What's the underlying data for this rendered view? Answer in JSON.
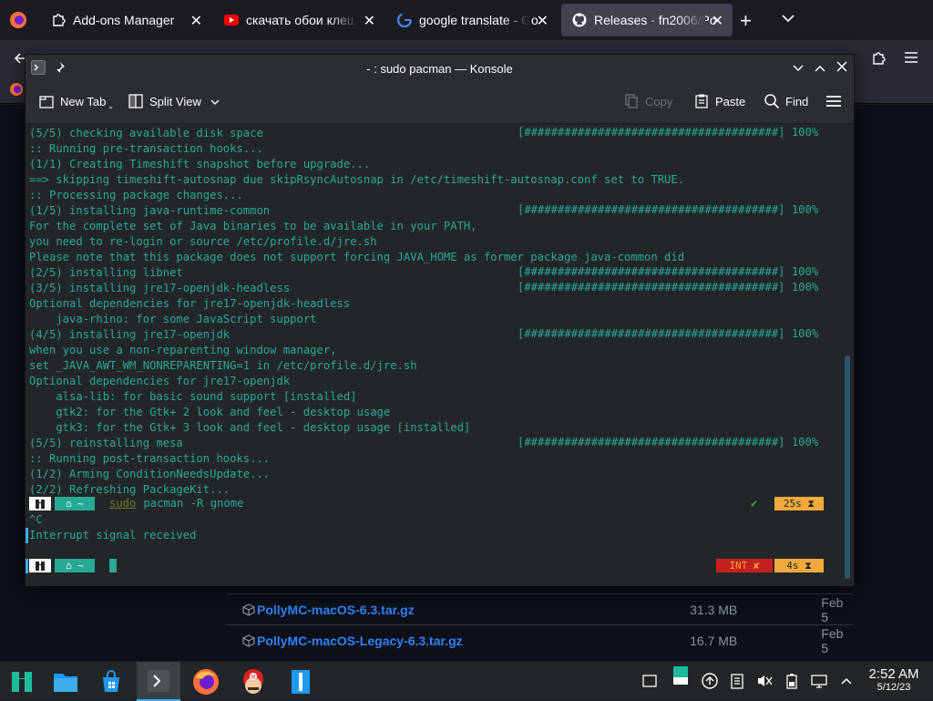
{
  "browser": {
    "tabs": [
      {
        "title": "Add-ons Manager",
        "icon": "puzzle-icon",
        "active": false
      },
      {
        "title": "скачать обои клеш р",
        "icon": "youtube-icon",
        "active": false
      },
      {
        "title": "google translate - Go",
        "icon": "google-icon",
        "active": false
      },
      {
        "title": "Releases · fn2006/Po",
        "icon": "github-icon",
        "active": true
      }
    ],
    "new_tab": "+",
    "list_tabs": "⌄"
  },
  "releases": {
    "assets": [
      {
        "name": "PollyMC-macOS-6.3.tar.gz",
        "size": "31.3 MB",
        "date": "Feb 5"
      },
      {
        "name": "PollyMC-macOS-Legacy-6.3.tar.gz",
        "size": "16.7 MB",
        "date": "Feb 5"
      }
    ]
  },
  "konsole": {
    "title": "- : sudo pacman — Konsole",
    "toolbar": {
      "new_tab": "New Tab",
      "split_view": "Split View",
      "copy": "Copy",
      "paste": "Paste",
      "find": "Find"
    },
    "lines": [
      {
        "text": "(5/5) checking available disk space",
        "bar": "[######################################] 100%"
      },
      {
        "text": ":: Running pre-transaction hooks...",
        "bar": ""
      },
      {
        "text": "(1/1) Creating Timeshift snapshot before upgrade...",
        "bar": ""
      },
      {
        "text": "==> skipping timeshift-autosnap due skipRsyncAutosnap in /etc/timeshift-autosnap.conf set to TRUE.",
        "bar": ""
      },
      {
        "text": ":: Processing package changes...",
        "bar": ""
      },
      {
        "text": "(1/5) installing java-runtime-common",
        "bar": "[######################################] 100%"
      },
      {
        "text": "For the complete set of Java binaries to be available in your PATH,",
        "bar": ""
      },
      {
        "text": "you need to re-login or source /etc/profile.d/jre.sh",
        "bar": ""
      },
      {
        "text": "Please note that this package does not support forcing JAVA_HOME as former package java-common did",
        "bar": ""
      },
      {
        "text": "(2/5) installing libnet",
        "bar": "[######################################] 100%"
      },
      {
        "text": "(3/5) installing jre17-openjdk-headless",
        "bar": "[######################################] 100%"
      },
      {
        "text": "Optional dependencies for jre17-openjdk-headless",
        "bar": ""
      },
      {
        "text": "    java-rhino: for some JavaScript support",
        "bar": ""
      },
      {
        "text": "(4/5) installing jre17-openjdk",
        "bar": "[######################################] 100%"
      },
      {
        "text": "when you use a non-reparenting window manager,",
        "bar": ""
      },
      {
        "text": "set _JAVA_AWT_WM_NONREPARENTING=1 in /etc/profile.d/jre.sh",
        "bar": ""
      },
      {
        "text": "Optional dependencies for jre17-openjdk",
        "bar": ""
      },
      {
        "text": "    alsa-lib: for basic sound support [installed]",
        "bar": ""
      },
      {
        "text": "    gtk2: for the Gtk+ 2 look and feel - desktop usage",
        "bar": ""
      },
      {
        "text": "    gtk3: for the Gtk+ 3 look and feel - desktop usage [installed]",
        "bar": ""
      },
      {
        "text": "(5/5) reinstalling mesa",
        "bar": "[######################################] 100%"
      },
      {
        "text": ":: Running post-transaction hooks...",
        "bar": ""
      },
      {
        "text": "(1/2) Arming ConditionNeedsUpdate...",
        "bar": ""
      },
      {
        "text": "(2/2) Refreshing PackageKit...",
        "bar": ""
      }
    ],
    "prompt1": {
      "os": "",
      "dir": "⌂ ~",
      "sudo": "sudo",
      "cmd": " pacman -R gnome",
      "check": "✔",
      "duration": "25s ⧗"
    },
    "interrupt_echo": "^C",
    "interrupt_msg": "Interrupt signal received",
    "prompt2": {
      "os": "",
      "dir": "⌂ ~",
      "status": "INT ✘",
      "duration": "4s ⧗"
    }
  },
  "taskbar": {
    "time": "2:52 AM",
    "date": "5/12/23"
  },
  "colors": {
    "accent": "#3daee9",
    "terminal_fg": "#27a993",
    "terminal_bg": "#232629",
    "duration_bg": "#f2a93b",
    "error_bg": "#c51f1f",
    "link": "#2f81f7"
  }
}
